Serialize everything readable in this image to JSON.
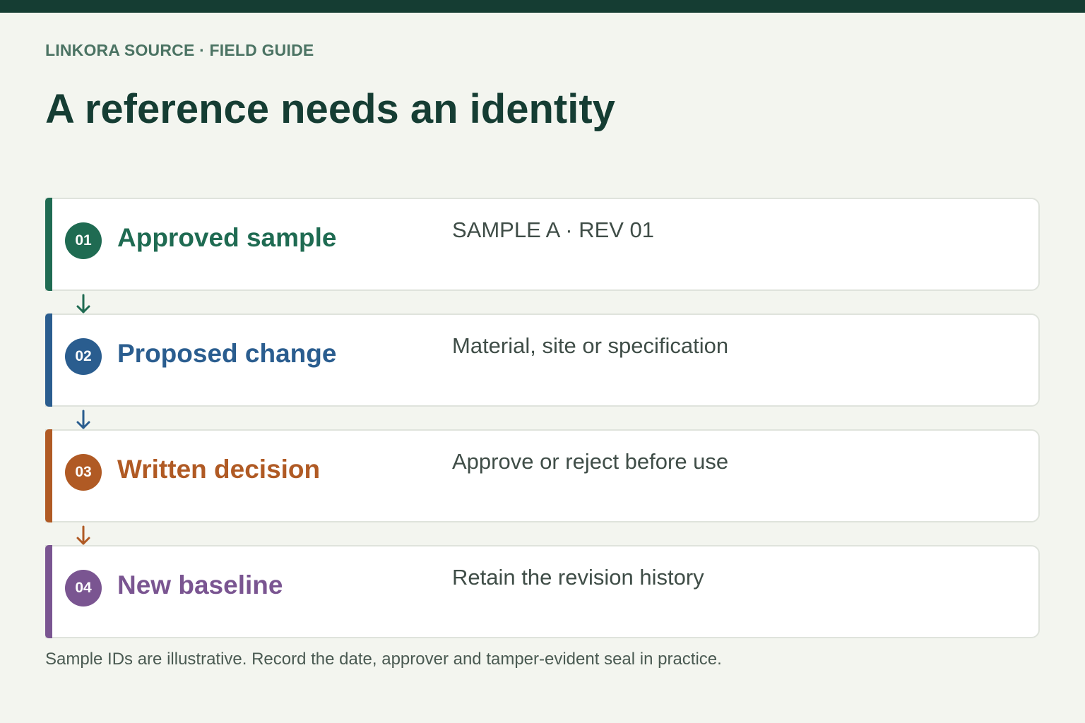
{
  "header": {
    "eyebrow": "LINKORA SOURCE · FIELD GUIDE",
    "title": "A reference needs an identity"
  },
  "steps": [
    {
      "number": "01",
      "title": "Approved sample",
      "detail": "SAMPLE A · REV 01",
      "color": "#1f6b52"
    },
    {
      "number": "02",
      "title": "Proposed change",
      "detail": "Material, site or specification",
      "color": "#2a5d8f"
    },
    {
      "number": "03",
      "title": "Written decision",
      "detail": "Approve or reject before use",
      "color": "#b05a24"
    },
    {
      "number": "04",
      "title": "New baseline",
      "detail": "Retain the revision history",
      "color": "#7a5591"
    }
  ],
  "arrows": [
    {
      "icon": "arrow-down-icon",
      "color": "#1f6b52"
    },
    {
      "icon": "arrow-down-icon",
      "color": "#2a5d8f"
    },
    {
      "icon": "arrow-down-icon",
      "color": "#b05a24"
    }
  ],
  "footnote": "Sample IDs are illustrative. Record the date, approver and tamper-evident seal in practice.",
  "colors": {
    "top_bar": "#153d33",
    "background": "#f3f5ef",
    "title": "#153d33",
    "eyebrow": "#4b7363"
  }
}
